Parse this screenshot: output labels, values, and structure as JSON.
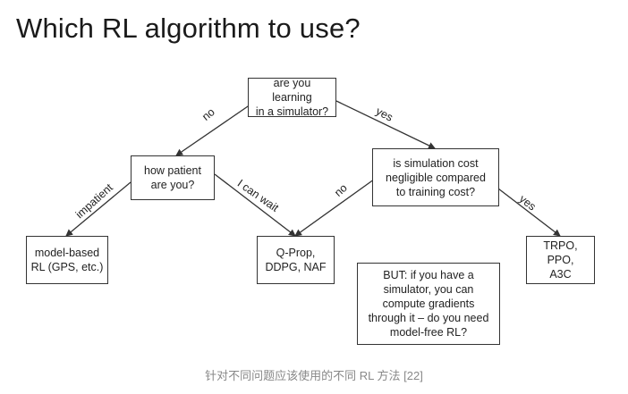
{
  "title": "Which RL algorithm to use?",
  "nodes": {
    "q_simulator": "are you learning\nin a simulator?",
    "q_patient": "how patient\nare you?",
    "q_sim_cost": "is simulation cost\nnegligible compared\nto training cost?",
    "a_model_based": "model-based\nRL (GPS, etc.)",
    "a_qprop": "Q-Prop,\nDDPG, NAF",
    "a_trpo": "TRPO, PPO,\nA3C",
    "note": "BUT: if you have a\nsimulator, you can\ncompute gradients\nthrough it – do you need\nmodel-free RL?"
  },
  "edges": {
    "no_1": "no",
    "yes_1": "yes",
    "impatient": "impatient",
    "can_wait": "I can wait",
    "no_2": "no",
    "yes_2": "yes"
  },
  "colors": {
    "line": "#333333",
    "caption": "#888888"
  },
  "caption": "针对不同问题应该使用的不同 RL 方法 [22]"
}
